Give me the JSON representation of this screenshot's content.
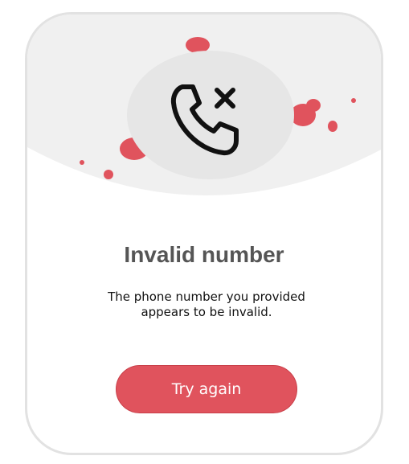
{
  "dialog": {
    "title": "Invalid number",
    "message": "The phone number you provided appears to be invalid.",
    "button_label": "Try again",
    "icon": "phone-x-icon"
  },
  "colors": {
    "accent": "#e0535d",
    "header_background": "#f0f0f0",
    "icon_circle": "#e6e6e6",
    "title": "#555555",
    "border": "#e2e2e2"
  }
}
